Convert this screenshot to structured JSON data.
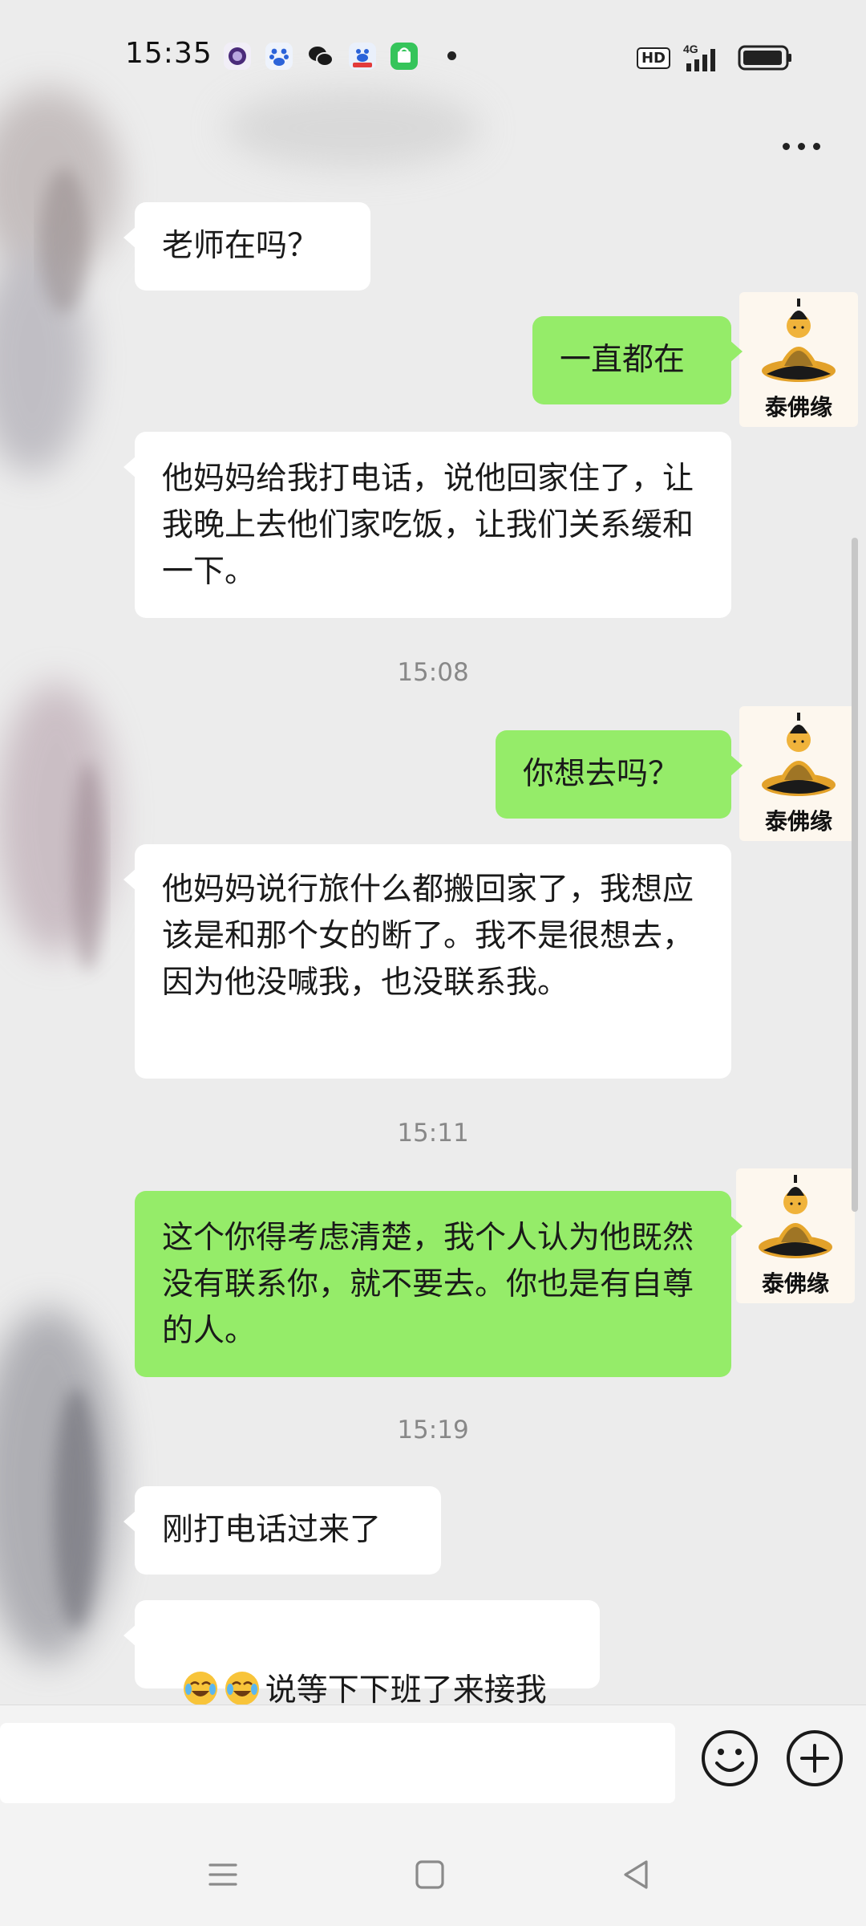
{
  "status_bar": {
    "time": "15:35",
    "network_badge": "HD",
    "signal_label": "4G",
    "left_icons": [
      "browser-app-icon",
      "baidu-paw-icon",
      "wechat-icon",
      "baidu-map-icon",
      "shopping-app-icon"
    ],
    "right_icons": [
      "hd-badge-icon",
      "signal-icon",
      "battery-icon"
    ]
  },
  "header": {
    "more_icon": "more-dots-icon"
  },
  "contact": {
    "avatar_label": "泰佛缘"
  },
  "messages": [
    {
      "side": "in",
      "text": "老师在吗？"
    },
    {
      "side": "out",
      "text": "一直都在"
    },
    {
      "side": "in",
      "text": "他妈妈给我打电话，说他回家住了，让我晚上去他们家吃饭，让我们关系缓和一下。"
    },
    {
      "side": "time",
      "text": "15:08"
    },
    {
      "side": "out",
      "text": "你想去吗？"
    },
    {
      "side": "in",
      "text": "他妈妈说行旅什么都搬回家了，我想应该是和那个女的断了。我不是很想去，因为他没喊我，也没联系我。"
    },
    {
      "side": "time",
      "text": "15:11"
    },
    {
      "side": "out",
      "text": "这个你得考虑清楚，我个人认为他既然没有联系你，就不要去。你也是有自尊的人。"
    },
    {
      "side": "time",
      "text": "15:19"
    },
    {
      "side": "in",
      "text": "刚打电话过来了"
    },
    {
      "side": "in",
      "text": "说等下下班了来接我",
      "prefix_emoji": [
        "crying-laughing-emoji",
        "crying-laughing-emoji"
      ]
    }
  ],
  "input_bar": {
    "placeholder": "",
    "emoji_button": "emoji-icon",
    "plus_button": "plus-icon"
  },
  "nav_bar": {
    "menu": "menu-icon",
    "home": "home-square-icon",
    "back": "back-triangle-icon"
  },
  "colors": {
    "incoming_bubble": "#ffffff",
    "outgoing_bubble": "#95ec69",
    "background": "#ececec",
    "timestamp": "#888888"
  }
}
